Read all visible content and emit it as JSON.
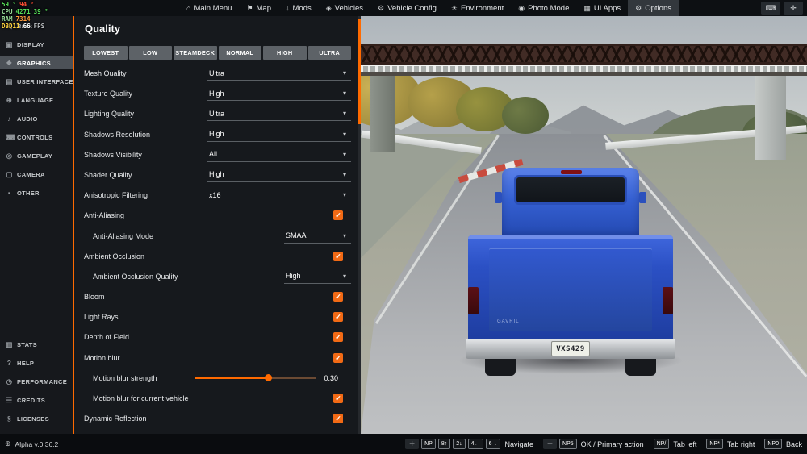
{
  "topbar": {
    "items": [
      {
        "label": "Main Menu",
        "icon": "main-menu",
        "active": false
      },
      {
        "label": "Map",
        "icon": "map",
        "active": false
      },
      {
        "label": "Mods",
        "icon": "mods",
        "active": false
      },
      {
        "label": "Vehicles",
        "icon": "vehicles",
        "active": false
      },
      {
        "label": "Vehicle Config",
        "icon": "vehicle-config",
        "active": false
      },
      {
        "label": "Environment",
        "icon": "environment",
        "active": false
      },
      {
        "label": "Photo Mode",
        "icon": "photo-mode",
        "active": false
      },
      {
        "label": "UI Apps",
        "icon": "ui-apps",
        "active": false
      },
      {
        "label": "Options",
        "icon": "options",
        "active": true
      }
    ],
    "right_icons": [
      "keyboard",
      "gamepad"
    ]
  },
  "sidebar": {
    "items": [
      {
        "label": "Back",
        "icon": "back"
      },
      {
        "label": "DISPLAY",
        "icon": "display"
      },
      {
        "label": "GRAPHICS",
        "icon": "graphics",
        "active": true
      },
      {
        "label": "USER INTERFACE",
        "icon": "user-interface"
      },
      {
        "label": "LANGUAGE",
        "icon": "language"
      },
      {
        "label": "AUDIO",
        "icon": "audio"
      },
      {
        "label": "CONTROLS",
        "icon": "controls"
      },
      {
        "label": "GAMEPLAY",
        "icon": "gameplay"
      },
      {
        "label": "CAMERA",
        "icon": "camera"
      },
      {
        "label": "OTHER",
        "icon": "other"
      },
      {
        "label": "STATS",
        "icon": "stats",
        "section": "bottom"
      },
      {
        "label": "HELP",
        "icon": "help",
        "section": "bottom"
      },
      {
        "label": "PERFORMANCE",
        "icon": "performance",
        "section": "bottom"
      },
      {
        "label": "CREDITS",
        "icon": "credits",
        "section": "bottom"
      },
      {
        "label": "LICENSES",
        "icon": "licenses",
        "section": "bottom"
      }
    ]
  },
  "perf_overlay": {
    "rows": [
      [
        {
          "text": "59 °",
          "color": "#57e05a"
        },
        {
          "text": "94 °",
          "color": "#ff4f35"
        }
      ],
      [
        {
          "text": "CPU",
          "color": "#9adf9a"
        },
        {
          "text": "4271",
          "color": "#57e05a"
        },
        {
          "text": "39 °",
          "color": "#57e05a"
        }
      ],
      [
        {
          "text": "RAM",
          "color": "#9adf9a"
        },
        {
          "text": "7314",
          "color": "#ff9b3c"
        }
      ],
      [
        {
          "text": "D3D11",
          "color": "#ffd23c"
        },
        {
          "text": "66",
          "color": "#ffffff"
        },
        {
          "text": "FPS",
          "color": "#b5b9bd"
        }
      ]
    ]
  },
  "panel": {
    "title": "Quality",
    "presets": [
      "LOWEST",
      "LOW",
      "STEAMDECK",
      "NORMAL",
      "HIGH",
      "ULTRA"
    ],
    "settings": [
      {
        "label": "Mesh Quality",
        "control": "select",
        "value": "Ultra",
        "indent": 0
      },
      {
        "label": "Texture Quality",
        "control": "select",
        "value": "High",
        "indent": 0
      },
      {
        "label": "Lighting Quality",
        "control": "select",
        "value": "Ultra",
        "indent": 0
      },
      {
        "label": "Shadows Resolution",
        "control": "select",
        "value": "High",
        "indent": 0
      },
      {
        "label": "Shadows Visibility",
        "control": "select",
        "value": "All",
        "indent": 0
      },
      {
        "label": "Shader Quality",
        "control": "select",
        "value": "High",
        "indent": 0
      },
      {
        "label": "Anisotropic Filtering",
        "control": "select",
        "value": "x16",
        "indent": 0
      },
      {
        "label": "Anti-Aliasing",
        "control": "checkbox",
        "checked": true,
        "indent": 0
      },
      {
        "label": "Anti-Aliasing Mode",
        "control": "select",
        "value": "SMAA",
        "indent": 1
      },
      {
        "label": "Ambient Occlusion",
        "control": "checkbox",
        "checked": true,
        "indent": 0
      },
      {
        "label": "Ambient Occlusion Quality",
        "control": "select",
        "value": "High",
        "indent": 1
      },
      {
        "label": "Bloom",
        "control": "checkbox",
        "checked": true,
        "indent": 0
      },
      {
        "label": "Light Rays",
        "control": "checkbox",
        "checked": true,
        "indent": 0
      },
      {
        "label": "Depth of Field",
        "control": "checkbox",
        "checked": true,
        "indent": 0
      },
      {
        "label": "Motion blur",
        "control": "checkbox",
        "checked": true,
        "indent": 0
      },
      {
        "label": "Motion blur strength",
        "control": "slider",
        "value": "0.30",
        "percent": 60,
        "indent": 1
      },
      {
        "label": "Motion blur for current vehicle",
        "control": "checkbox",
        "checked": true,
        "indent": 1
      },
      {
        "label": "Dynamic Reflection",
        "control": "checkbox",
        "checked": true,
        "indent": 0
      }
    ]
  },
  "scene": {
    "license_plate": "VXS429",
    "tailgate_badge": "GAVRIL"
  },
  "bottombar": {
    "version": "Alpha v.0.36.2",
    "hints": [
      {
        "icon": "gamepad",
        "keys": [
          "NP",
          "8↑",
          "2↓",
          "4←",
          "6→"
        ],
        "label": "Navigate"
      },
      {
        "icon": "gamepad",
        "keys": [
          "NP5"
        ],
        "label": "OK / Primary action"
      },
      {
        "keys": [
          "NP/"
        ],
        "label": "Tab left"
      },
      {
        "keys": [
          "NP*"
        ],
        "label": "Tab right"
      },
      {
        "keys": [
          "NP0"
        ],
        "label": "Back"
      }
    ]
  },
  "colors": {
    "accent": "#ff6a00",
    "checkbox": "#f26a15"
  }
}
